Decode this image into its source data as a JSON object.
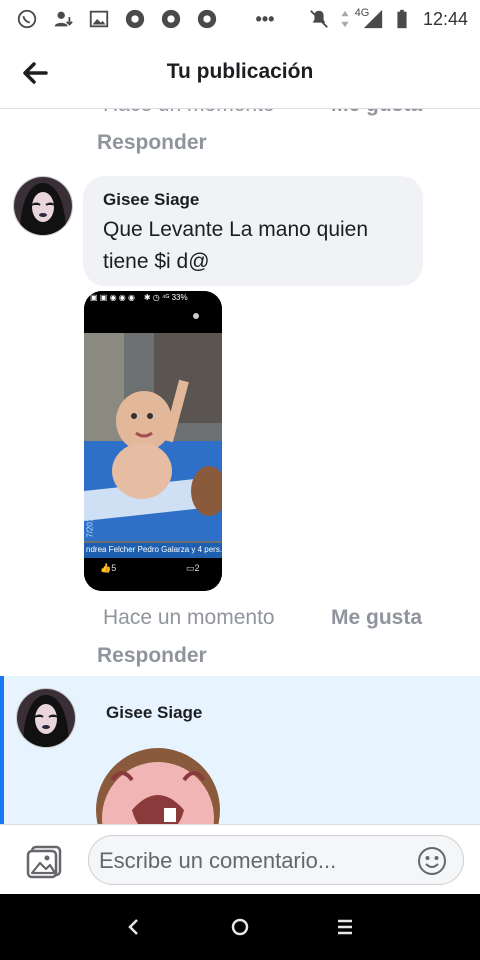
{
  "status_bar": {
    "time": "12:44",
    "network": "4G",
    "icons": [
      "whatsapp-icon",
      "person-upload-icon",
      "gallery-icon",
      "chrome-icon",
      "chrome-icon",
      "chrome-icon",
      "more-icon",
      "mute-icon",
      "signal-icon",
      "battery-icon"
    ]
  },
  "header": {
    "title": "Tu publicación"
  },
  "top_comment": {
    "time_label": "Hace un momento",
    "like_label": "Me gusta",
    "reply_label": "Responder"
  },
  "comment_1": {
    "author": "Gisee Siage",
    "text": "Que Levante La mano quien tiene $i d@",
    "photo": {
      "status_text": "33%",
      "caption": "ndrea Felcher Pedro Galarza y 4 pers...",
      "likes": "5",
      "comments": "2",
      "side_text": "7/2012"
    },
    "time_label": "Hace un momento",
    "like_label": "Me gusta",
    "reply_label": "Responder"
  },
  "comment_2": {
    "author": "Gisee Siage"
  },
  "composer": {
    "placeholder": "Escribe un comentario..."
  },
  "colors": {
    "accent": "#1877f2",
    "highlight_bg": "#e7f3ff",
    "meta_gray": "#90949c"
  }
}
